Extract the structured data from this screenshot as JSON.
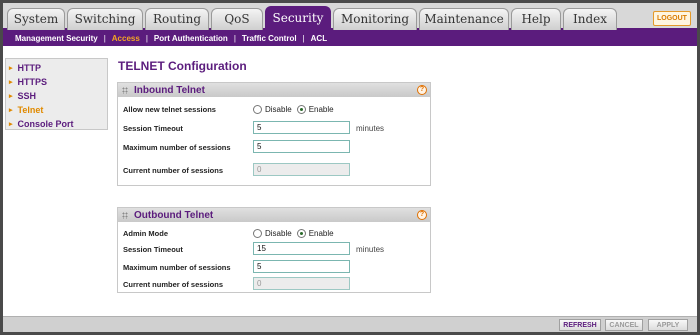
{
  "top_tabs": [
    "System",
    "Switching",
    "Routing",
    "QoS",
    "Security",
    "Monitoring",
    "Maintenance",
    "Help",
    "Index"
  ],
  "active_tab": "Security",
  "logout_label": "LOGOUT",
  "sub_nav": [
    "Management Security",
    "Access",
    "Port Authentication",
    "Traffic Control",
    "ACL"
  ],
  "sub_nav_active": "Access",
  "sidebar": [
    "HTTP",
    "HTTPS",
    "SSH",
    "Telnet",
    "Console Port"
  ],
  "sidebar_active": "Telnet",
  "page_title": "TELNET Configuration",
  "inbound": {
    "title": "Inbound Telnet",
    "allow_label": "Allow new telnet sessions",
    "disable_label": "Disable",
    "enable_label": "Enable",
    "selected": "Enable",
    "timeout_label": "Session Timeout",
    "timeout_value": "5",
    "timeout_unit": "minutes",
    "max_label": "Maximum number of sessions",
    "max_value": "5",
    "current_label": "Current number of sessions",
    "current_value": "0"
  },
  "outbound": {
    "title": "Outbound Telnet",
    "admin_label": "Admin Mode",
    "disable_label": "Disable",
    "enable_label": "Enable",
    "selected": "Enable",
    "timeout_label": "Session Timeout",
    "timeout_value": "15",
    "timeout_unit": "minutes",
    "max_label": "Maximum number of sessions",
    "max_value": "5",
    "current_label": "Current number of sessions",
    "current_value": "0"
  },
  "help_glyph": "?",
  "buttons": {
    "refresh": "REFRESH",
    "cancel": "CANCEL",
    "apply": "APPLY"
  }
}
